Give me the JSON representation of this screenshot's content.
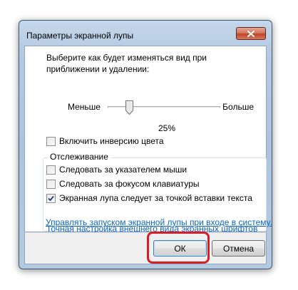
{
  "window": {
    "title": "Параметры экранной лупы"
  },
  "description": "Выберите как будет изменяться вид при приближении и удалении:",
  "slider": {
    "min_label": "Меньше",
    "max_label": "Больше",
    "value_text": "25%",
    "value_fraction": 0.2
  },
  "invert_colors": {
    "label": "Включить инверсию цвета",
    "checked": false
  },
  "tracking": {
    "title": "Отслеживание",
    "options": [
      {
        "label": "Следовать за указателем мыши",
        "checked": false
      },
      {
        "label": "Следовать за фокусом клавиатуры",
        "checked": false
      },
      {
        "label": "Экранная лупа следует за точкой вставки текста",
        "checked": true
      }
    ]
  },
  "links": [
    "Точная настройка внешнего вида экранных шрифтов",
    "Управлять запуском экранной лупы при входе в систему."
  ],
  "buttons": {
    "ok": "ОК",
    "cancel": "Отмена"
  },
  "colors": {
    "highlight": "#d51e28",
    "link": "#0f66c2",
    "close_button": "#c0452a"
  },
  "icons": {
    "close": "close-icon",
    "checkmark": "checkmark-icon"
  }
}
